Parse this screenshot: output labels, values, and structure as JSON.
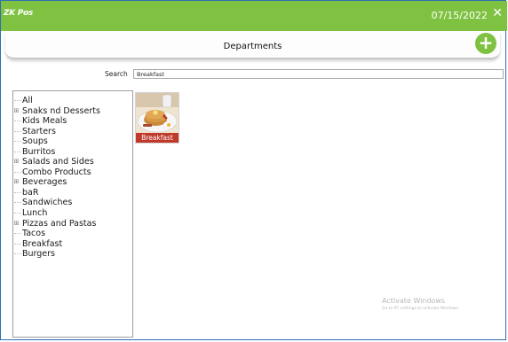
{
  "header": {
    "logo_text": "ZK Pos",
    "date": "07/15/2022",
    "close_glyph": "✕",
    "bar_color": "#7fc242"
  },
  "toolbar": {
    "title": "Departments",
    "add_glyph": "+"
  },
  "search": {
    "label": "Search",
    "value": "Breakfast"
  },
  "departments": [
    {
      "label": "All",
      "expandable": false
    },
    {
      "label": "Snaks nd Desserts",
      "expandable": true
    },
    {
      "label": "Kids Meals",
      "expandable": false
    },
    {
      "label": "Starters",
      "expandable": false
    },
    {
      "label": "Soups",
      "expandable": false
    },
    {
      "label": "Burritos",
      "expandable": false
    },
    {
      "label": "Salads and Sides",
      "expandable": true
    },
    {
      "label": "Combo Products",
      "expandable": false
    },
    {
      "label": "Beverages",
      "expandable": true
    },
    {
      "label": "baR",
      "expandable": false
    },
    {
      "label": "Sandwiches",
      "expandable": false
    },
    {
      "label": "Lunch",
      "expandable": false
    },
    {
      "label": "Pizzas and Pastas",
      "expandable": true
    },
    {
      "label": "Tacos",
      "expandable": false
    },
    {
      "label": "Breakfast",
      "expandable": false
    },
    {
      "label": "Burgers",
      "expandable": false
    }
  ],
  "results": [
    {
      "label": "Breakfast",
      "image": "breakfast-plate-image",
      "label_color": "#c0392b"
    }
  ],
  "watermark": {
    "line1": "Activate Windows",
    "line2": "Go to PC settings to activate Windows."
  }
}
